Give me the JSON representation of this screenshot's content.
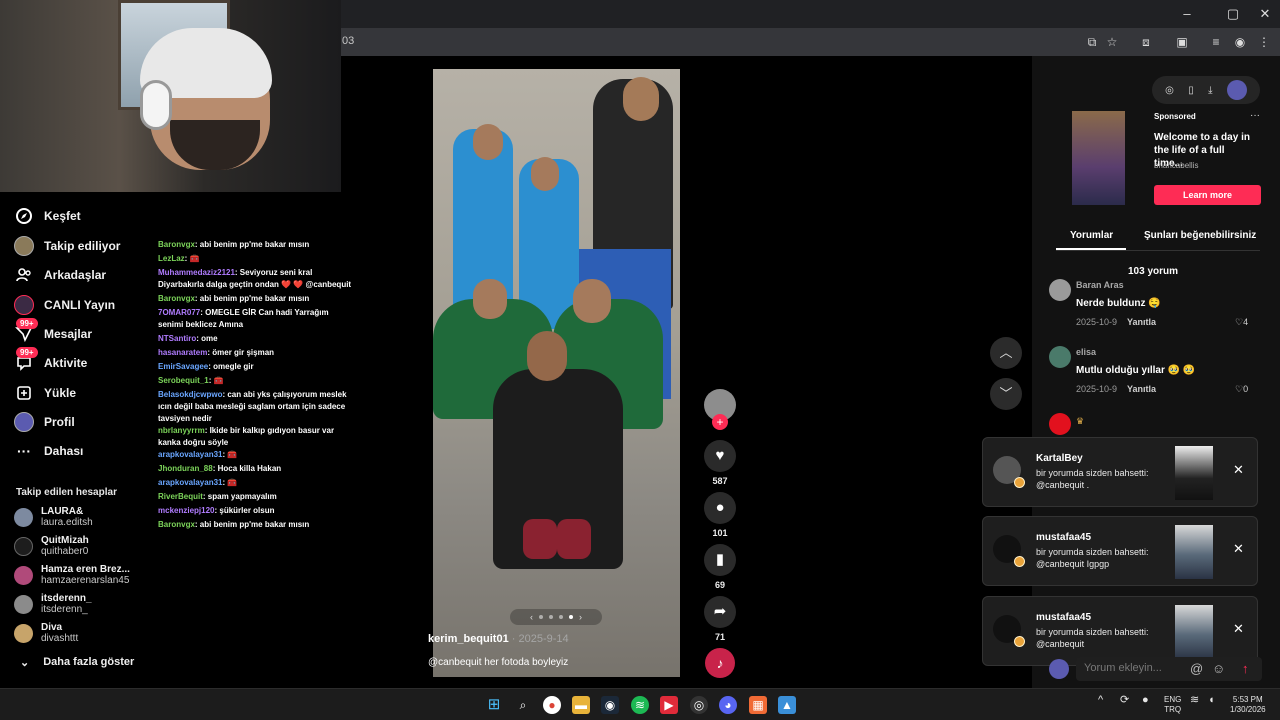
{
  "browser": {
    "url_fragment": "03",
    "window_controls": {
      "minimize": "–",
      "maximize": "▢",
      "close": "✕"
    }
  },
  "nav": {
    "items": [
      {
        "label": "Keşfet",
        "icon": "compass-icon"
      },
      {
        "label": "Takip ediliyor",
        "icon": "following-avatar"
      },
      {
        "label": "Arkadaşlar",
        "icon": "friends-icon"
      },
      {
        "label": "CANLI Yayın",
        "icon": "live-icon"
      },
      {
        "label": "Mesajlar",
        "icon": "messages-icon",
        "badge": "99+"
      },
      {
        "label": "Aktivite",
        "icon": "activity-icon",
        "badge": "99+"
      },
      {
        "label": "Yükle",
        "icon": "upload-icon"
      },
      {
        "label": "Profil",
        "icon": "profile-avatar"
      },
      {
        "label": "Dahası",
        "icon": "more-icon"
      }
    ],
    "following_header": "Takip edilen hesaplar",
    "following": [
      {
        "name": "LAURA&",
        "handle": "laura.editsh"
      },
      {
        "name": "QuitMizah",
        "handle": "quithaber0"
      },
      {
        "name": "Hamza eren Brez...",
        "handle": "hamzaerenarslan45"
      },
      {
        "name": "itsderenn_",
        "handle": "itsderenn_"
      },
      {
        "name": "Diva",
        "handle": "divashttt"
      }
    ],
    "show_more": "Daha fazla göster"
  },
  "chat": [
    {
      "user": "Baronvgx",
      "color": "#7cd45a",
      "text": ": abi benim pp'me bakar mısın"
    },
    {
      "user": "LezLaz",
      "color": "#7cd45a",
      "text": ": 🧰"
    },
    {
      "user": "Muhammedaziz2121",
      "color": "#b07cff",
      "text": ": Seviyoruz seni kral"
    },
    {
      "user": "",
      "color": "#fff",
      "text": "Diyarbakırla dalga geçtin ondan ❤️ ❤️ @canbequit"
    },
    {
      "user": "Baronvgx",
      "color": "#7cd45a",
      "text": ": abi benim pp'me bakar mısın"
    },
    {
      "user": "7OMAR077",
      "color": "#b07cff",
      "text": ": OMEGLE GİR Can hadi Yarrağım"
    },
    {
      "user": "",
      "color": "#fff",
      "text": "senimi beklicez Amına"
    },
    {
      "user": "NTSantiro",
      "color": "#b07cff",
      "text": ": ome"
    },
    {
      "user": "hasanaratem",
      "color": "#b07cff",
      "text": ": ömer gir şişman"
    },
    {
      "user": "EmirSavagee",
      "color": "#6aa6ff",
      "text": ": omegle gir"
    },
    {
      "user": "Serobequit_1",
      "color": "#7cd45a",
      "text": ": 🧰"
    },
    {
      "user": "Belasokdjcwpwo",
      "color": "#6aa6ff",
      "text": ": can abi yks çalışıyorum meslek"
    },
    {
      "user": "",
      "color": "#fff",
      "text": "ıcın değil baba mesleği saglam ortam için sadece"
    },
    {
      "user": "",
      "color": "#fff",
      "text": "tavsiyen nedir"
    },
    {
      "user": "nbrlanyyrrm",
      "color": "#7cd45a",
      "text": ": Ikide bir kalkıp gıdıyon basur var"
    },
    {
      "user": "",
      "color": "#fff",
      "text": "kanka doğru söyle"
    },
    {
      "user": "arapkovalayan31",
      "color": "#6aa6ff",
      "text": ": 🧰"
    },
    {
      "user": "Jhonduran_88",
      "color": "#7cd45a",
      "text": ": Hoca killa Hakan"
    },
    {
      "user": "arapkovalayan31",
      "color": "#6aa6ff",
      "text": ": 🧰"
    },
    {
      "user": "RiverBequit",
      "color": "#7cd45a",
      "text": ": spam yapmayalım"
    },
    {
      "user": "mckenziepj120",
      "color": "#b07cff",
      "text": ": şükürler olsun"
    },
    {
      "user": "Baronvgx",
      "color": "#7cd45a",
      "text": ": abi benim pp'me bakar mısın"
    }
  ],
  "video": {
    "author": "kerim_bequit01",
    "date": " · 2025-9-14",
    "caption": "@canbequit her fotoda boyleyiz",
    "carousel_active": 3,
    "carousel_count": 4,
    "actions": {
      "likes": "587",
      "comments": "101",
      "saves": "69",
      "shares": "71"
    }
  },
  "sponsored": {
    "label": "Sponsored",
    "title": "Welcome to a day in the life of a full time...",
    "user": "briancabellis",
    "cta": "Learn more"
  },
  "tabs": {
    "comments": "Yorumlar",
    "you_may_like": "Şunları beğenebilirsiniz"
  },
  "comments": {
    "count": "103 yorum",
    "list": [
      {
        "user": "Baran Aras",
        "text": "Nerde buldunz 🤤",
        "date": "2025-10-9",
        "reply": "Yanıtla",
        "likes": "4"
      },
      {
        "user": "elisa",
        "text": "Mutlu olduğu yıllar 🥹 🥹",
        "date": "2025-10-9",
        "reply": "Yanıtla",
        "likes": "0"
      }
    ],
    "input_placeholder": "Yorum ekleyin..."
  },
  "notifications": [
    {
      "user": "KartalBey",
      "text": "bir yorumda sizden bahsetti: @canbequit ."
    },
    {
      "user": "mustafaa45",
      "text": "bir yorumda sizden bahsetti: @canbequit Igpgp"
    },
    {
      "user": "mustafaa45",
      "text": "bir yorumda sizden bahsetti: @canbequit"
    }
  ],
  "taskbar": {
    "lang": "ENG",
    "layout": "TRQ",
    "time": "5:53 PM",
    "date": "1/30/2026"
  },
  "colors": {
    "accent": "#fe2c55",
    "background": "#000000",
    "panel": "#121212"
  }
}
